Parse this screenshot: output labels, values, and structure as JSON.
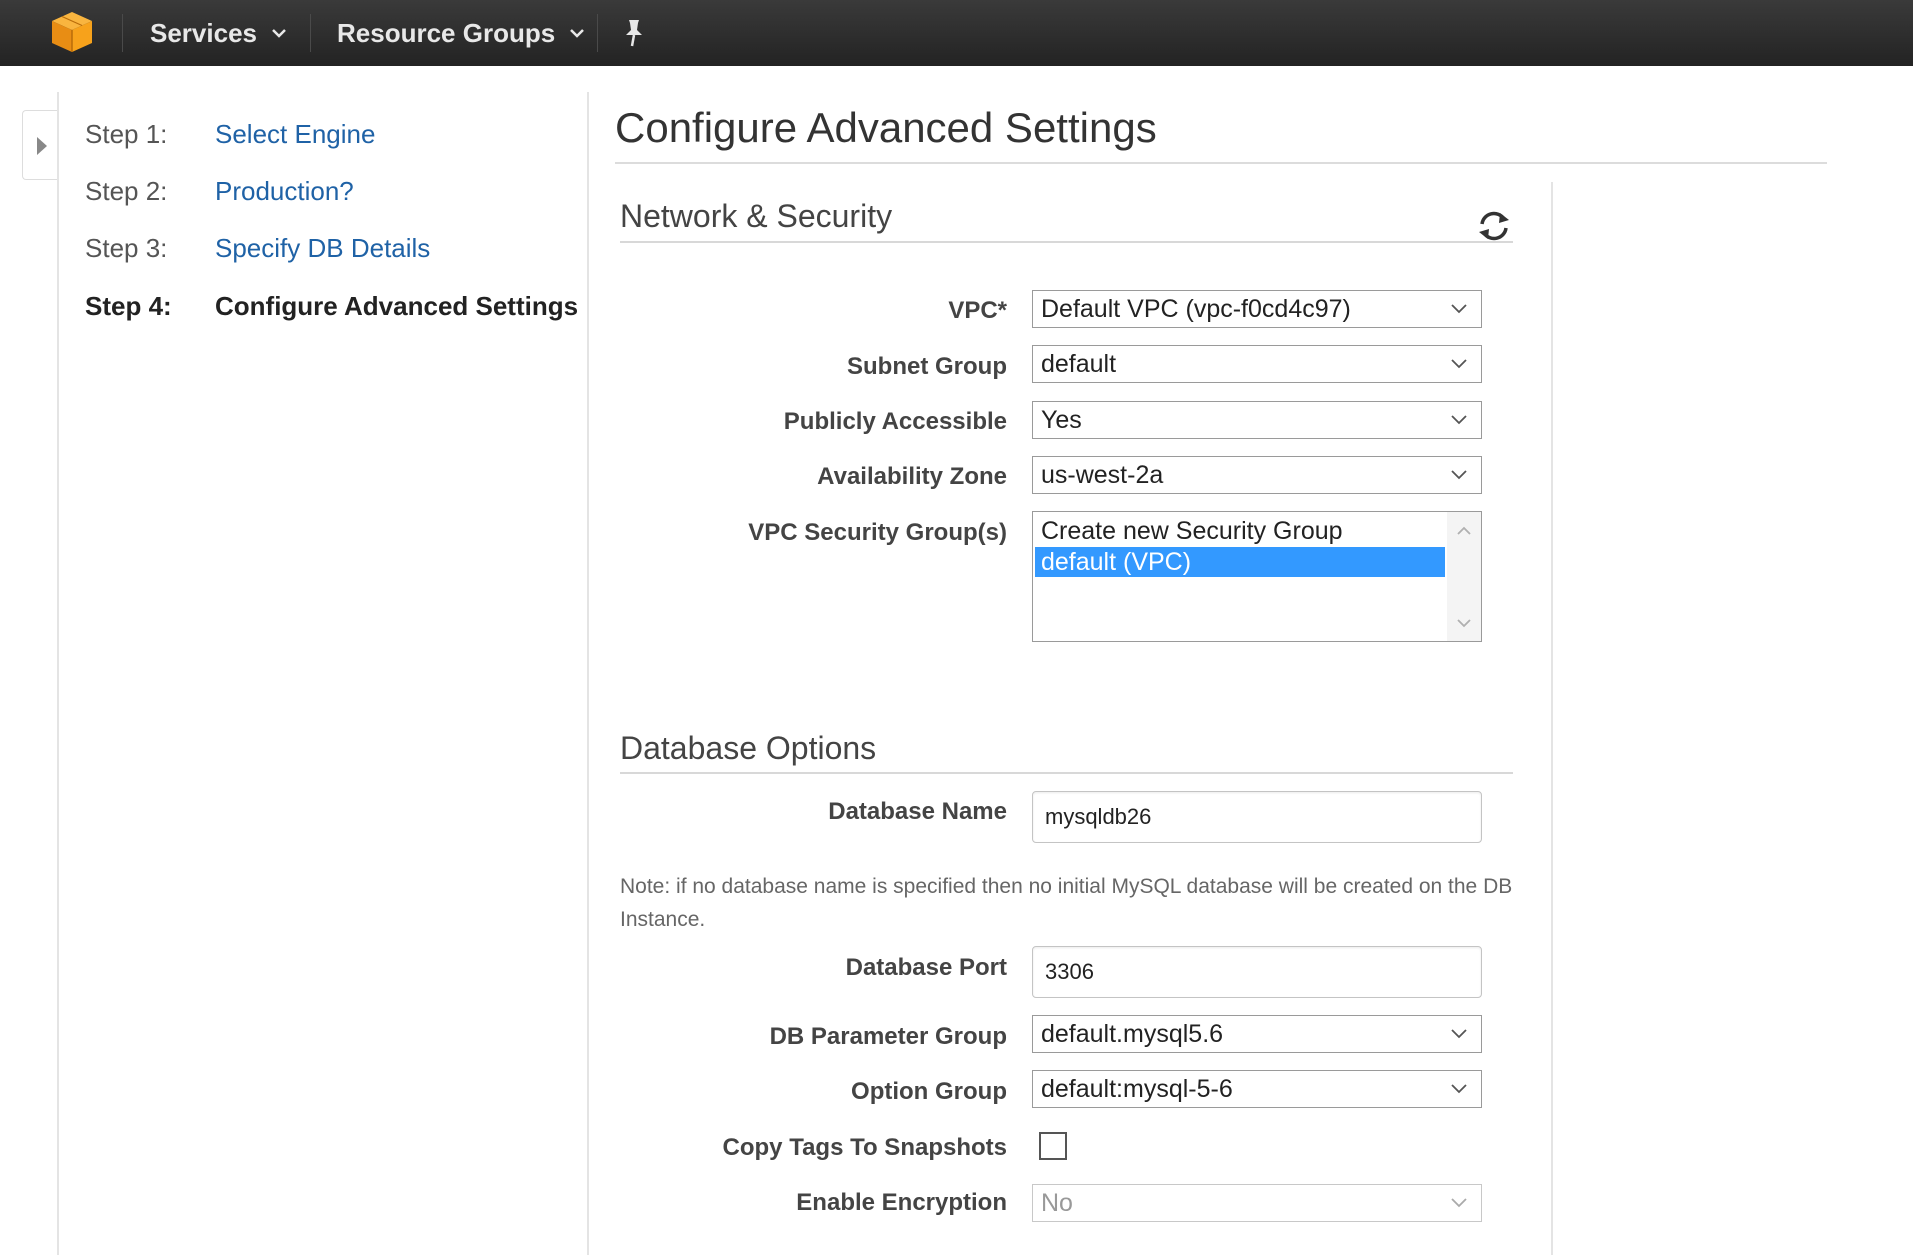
{
  "nav": {
    "services_label": "Services",
    "resource_groups_label": "Resource Groups",
    "logo_icon": "aws-cube-icon",
    "pin_icon": "pin-icon",
    "colors": {
      "bar": "#2b2b2b",
      "logo": "#f7a21b",
      "text": "#e8e8e8"
    }
  },
  "steps": [
    {
      "num": "Step 1:",
      "label": "Select Engine"
    },
    {
      "num": "Step 2:",
      "label": "Production?"
    },
    {
      "num": "Step 3:",
      "label": "Specify DB Details"
    },
    {
      "num": "Step 4:",
      "label": "Configure Advanced Settings"
    }
  ],
  "page": {
    "title": "Configure Advanced Settings"
  },
  "network": {
    "title": "Network & Security",
    "vpc_label": "VPC*",
    "vpc_value": "Default VPC (vpc-f0cd4c97)",
    "subnet_label": "Subnet Group",
    "subnet_value": "default",
    "public_label": "Publicly Accessible",
    "public_value": "Yes",
    "az_label": "Availability Zone",
    "az_value": "us-west-2a",
    "sg_label": "VPC Security Group(s)",
    "sg_options": [
      "Create new Security Group",
      "default (VPC)"
    ],
    "sg_selected": "default (VPC)"
  },
  "database": {
    "title": "Database Options",
    "name_label": "Database Name",
    "name_value": "mysqldb26",
    "note": "Note: if no database name is specified then no initial MySQL database will be created on the DB Instance.",
    "port_label": "Database Port",
    "port_value": "3306",
    "param_label": "DB Parameter Group",
    "param_value": "default.mysql5.6",
    "option_label": "Option Group",
    "option_value": "default:mysql-5-6",
    "copytags_label": "Copy Tags To Snapshots",
    "copytags_checked": false,
    "encrypt_label": "Enable Encryption",
    "encrypt_value": "No"
  },
  "colors": {
    "link": "#1f62a6",
    "selection": "#3399ff"
  }
}
